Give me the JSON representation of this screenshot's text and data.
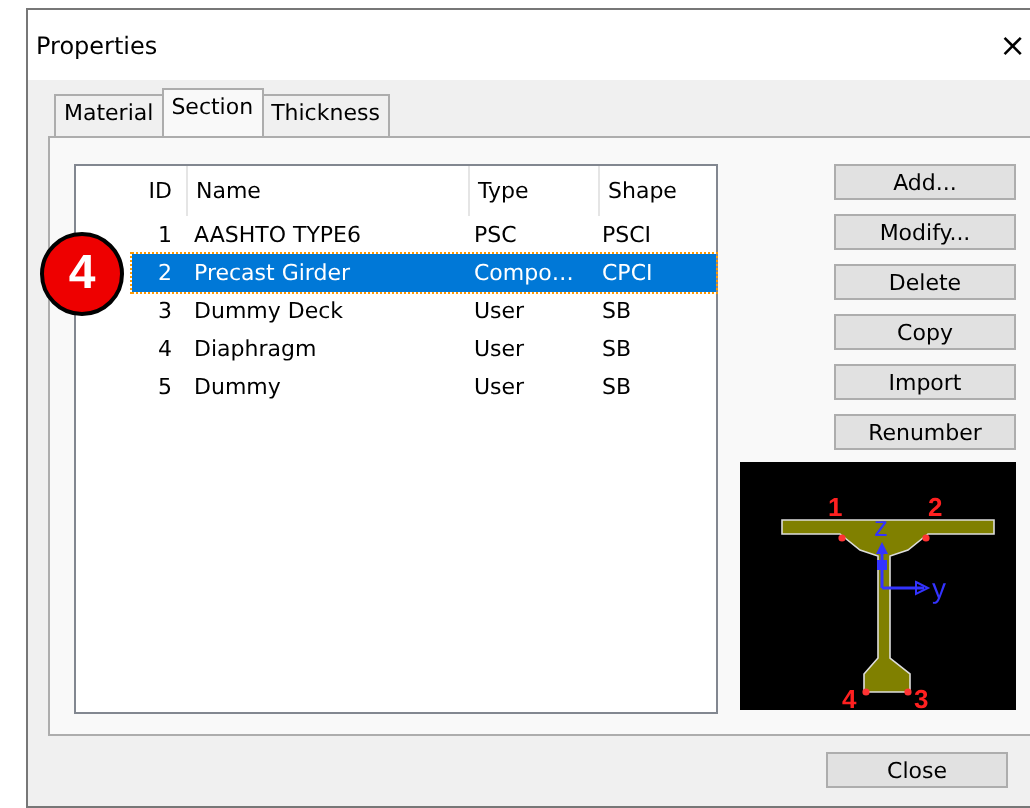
{
  "window": {
    "title": "Properties",
    "close_glyph": "×"
  },
  "tabs": [
    {
      "label": "Material",
      "selected": false
    },
    {
      "label": "Section",
      "selected": true
    },
    {
      "label": "Thickness",
      "selected": false
    }
  ],
  "table": {
    "columns": [
      "ID",
      "Name",
      "Type",
      "Shape"
    ],
    "rows": [
      {
        "id": "1",
        "name": "AASHTO TYPE6",
        "type": "PSC",
        "shape": "PSCI",
        "selected": false
      },
      {
        "id": "2",
        "name": "Precast Girder",
        "type": "Compo…",
        "shape": "CPCI",
        "selected": true
      },
      {
        "id": "3",
        "name": "Dummy Deck",
        "type": "User",
        "shape": "SB",
        "selected": false
      },
      {
        "id": "4",
        "name": "Diaphragm",
        "type": "User",
        "shape": "SB",
        "selected": false
      },
      {
        "id": "5",
        "name": "Dummy",
        "type": "User",
        "shape": "SB",
        "selected": false
      }
    ]
  },
  "callout": "4",
  "buttons": [
    "Add...",
    "Modify...",
    "Delete",
    "Copy",
    "Import",
    "Renumber"
  ],
  "preview": {
    "point_labels": [
      "1",
      "2",
      "4",
      "3"
    ],
    "axis_labels": [
      "z",
      "y"
    ]
  },
  "footer_button": "Close"
}
